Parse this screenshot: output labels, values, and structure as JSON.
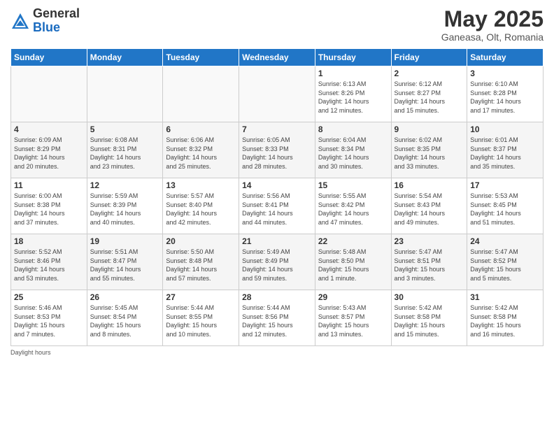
{
  "logo": {
    "general": "General",
    "blue": "Blue"
  },
  "header": {
    "month": "May 2025",
    "location": "Ganeasa, Olt, Romania"
  },
  "days_of_week": [
    "Sunday",
    "Monday",
    "Tuesday",
    "Wednesday",
    "Thursday",
    "Friday",
    "Saturday"
  ],
  "weeks": [
    [
      {
        "day": "",
        "info": ""
      },
      {
        "day": "",
        "info": ""
      },
      {
        "day": "",
        "info": ""
      },
      {
        "day": "",
        "info": ""
      },
      {
        "day": "1",
        "info": "Sunrise: 6:13 AM\nSunset: 8:26 PM\nDaylight: 14 hours\nand 12 minutes."
      },
      {
        "day": "2",
        "info": "Sunrise: 6:12 AM\nSunset: 8:27 PM\nDaylight: 14 hours\nand 15 minutes."
      },
      {
        "day": "3",
        "info": "Sunrise: 6:10 AM\nSunset: 8:28 PM\nDaylight: 14 hours\nand 17 minutes."
      }
    ],
    [
      {
        "day": "4",
        "info": "Sunrise: 6:09 AM\nSunset: 8:29 PM\nDaylight: 14 hours\nand 20 minutes."
      },
      {
        "day": "5",
        "info": "Sunrise: 6:08 AM\nSunset: 8:31 PM\nDaylight: 14 hours\nand 23 minutes."
      },
      {
        "day": "6",
        "info": "Sunrise: 6:06 AM\nSunset: 8:32 PM\nDaylight: 14 hours\nand 25 minutes."
      },
      {
        "day": "7",
        "info": "Sunrise: 6:05 AM\nSunset: 8:33 PM\nDaylight: 14 hours\nand 28 minutes."
      },
      {
        "day": "8",
        "info": "Sunrise: 6:04 AM\nSunset: 8:34 PM\nDaylight: 14 hours\nand 30 minutes."
      },
      {
        "day": "9",
        "info": "Sunrise: 6:02 AM\nSunset: 8:35 PM\nDaylight: 14 hours\nand 33 minutes."
      },
      {
        "day": "10",
        "info": "Sunrise: 6:01 AM\nSunset: 8:37 PM\nDaylight: 14 hours\nand 35 minutes."
      }
    ],
    [
      {
        "day": "11",
        "info": "Sunrise: 6:00 AM\nSunset: 8:38 PM\nDaylight: 14 hours\nand 37 minutes."
      },
      {
        "day": "12",
        "info": "Sunrise: 5:59 AM\nSunset: 8:39 PM\nDaylight: 14 hours\nand 40 minutes."
      },
      {
        "day": "13",
        "info": "Sunrise: 5:57 AM\nSunset: 8:40 PM\nDaylight: 14 hours\nand 42 minutes."
      },
      {
        "day": "14",
        "info": "Sunrise: 5:56 AM\nSunset: 8:41 PM\nDaylight: 14 hours\nand 44 minutes."
      },
      {
        "day": "15",
        "info": "Sunrise: 5:55 AM\nSunset: 8:42 PM\nDaylight: 14 hours\nand 47 minutes."
      },
      {
        "day": "16",
        "info": "Sunrise: 5:54 AM\nSunset: 8:43 PM\nDaylight: 14 hours\nand 49 minutes."
      },
      {
        "day": "17",
        "info": "Sunrise: 5:53 AM\nSunset: 8:45 PM\nDaylight: 14 hours\nand 51 minutes."
      }
    ],
    [
      {
        "day": "18",
        "info": "Sunrise: 5:52 AM\nSunset: 8:46 PM\nDaylight: 14 hours\nand 53 minutes."
      },
      {
        "day": "19",
        "info": "Sunrise: 5:51 AM\nSunset: 8:47 PM\nDaylight: 14 hours\nand 55 minutes."
      },
      {
        "day": "20",
        "info": "Sunrise: 5:50 AM\nSunset: 8:48 PM\nDaylight: 14 hours\nand 57 minutes."
      },
      {
        "day": "21",
        "info": "Sunrise: 5:49 AM\nSunset: 8:49 PM\nDaylight: 14 hours\nand 59 minutes."
      },
      {
        "day": "22",
        "info": "Sunrise: 5:48 AM\nSunset: 8:50 PM\nDaylight: 15 hours\nand 1 minute."
      },
      {
        "day": "23",
        "info": "Sunrise: 5:47 AM\nSunset: 8:51 PM\nDaylight: 15 hours\nand 3 minutes."
      },
      {
        "day": "24",
        "info": "Sunrise: 5:47 AM\nSunset: 8:52 PM\nDaylight: 15 hours\nand 5 minutes."
      }
    ],
    [
      {
        "day": "25",
        "info": "Sunrise: 5:46 AM\nSunset: 8:53 PM\nDaylight: 15 hours\nand 7 minutes."
      },
      {
        "day": "26",
        "info": "Sunrise: 5:45 AM\nSunset: 8:54 PM\nDaylight: 15 hours\nand 8 minutes."
      },
      {
        "day": "27",
        "info": "Sunrise: 5:44 AM\nSunset: 8:55 PM\nDaylight: 15 hours\nand 10 minutes."
      },
      {
        "day": "28",
        "info": "Sunrise: 5:44 AM\nSunset: 8:56 PM\nDaylight: 15 hours\nand 12 minutes."
      },
      {
        "day": "29",
        "info": "Sunrise: 5:43 AM\nSunset: 8:57 PM\nDaylight: 15 hours\nand 13 minutes."
      },
      {
        "day": "30",
        "info": "Sunrise: 5:42 AM\nSunset: 8:58 PM\nDaylight: 15 hours\nand 15 minutes."
      },
      {
        "day": "31",
        "info": "Sunrise: 5:42 AM\nSunset: 8:58 PM\nDaylight: 15 hours\nand 16 minutes."
      }
    ]
  ],
  "footer": {
    "note": "Daylight hours"
  }
}
